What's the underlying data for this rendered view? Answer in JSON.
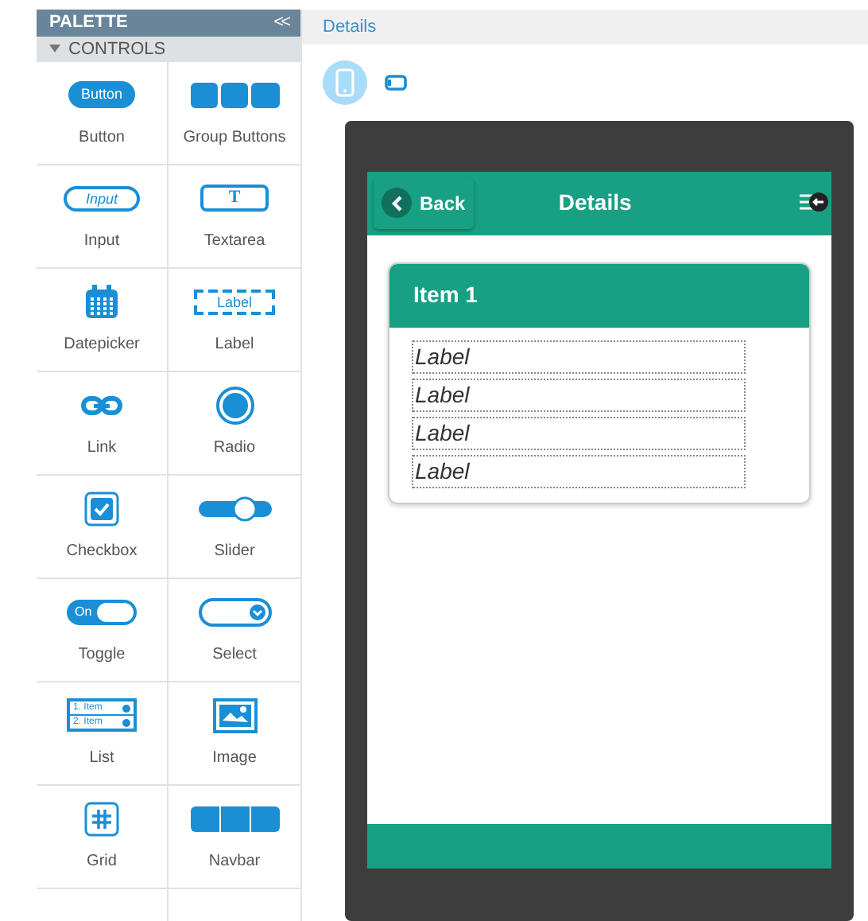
{
  "palette": {
    "title": "PALETTE",
    "collapse": "<<",
    "section": {
      "title": "CONTROLS",
      "expanded": true
    },
    "items": [
      {
        "kind": "button",
        "label": "Button",
        "icon_text": [
          "Button"
        ]
      },
      {
        "kind": "group",
        "label": "Group Buttons"
      },
      {
        "kind": "input",
        "label": "Input",
        "icon_text": [
          "Input"
        ]
      },
      {
        "kind": "textarea",
        "label": "Textarea",
        "icon_text": [
          "T"
        ]
      },
      {
        "kind": "datepicker",
        "label": "Datepicker"
      },
      {
        "kind": "label",
        "label": "Label",
        "icon_text": [
          "Label"
        ]
      },
      {
        "kind": "link",
        "label": "Link"
      },
      {
        "kind": "radio",
        "label": "Radio"
      },
      {
        "kind": "checkbox",
        "label": "Checkbox"
      },
      {
        "kind": "slider",
        "label": "Slider"
      },
      {
        "kind": "toggle",
        "label": "Toggle",
        "icon_text": [
          "On"
        ]
      },
      {
        "kind": "select",
        "label": "Select"
      },
      {
        "kind": "list",
        "label": "List",
        "icon_text": [
          "1. Item",
          "2. Item"
        ]
      },
      {
        "kind": "image",
        "label": "Image"
      },
      {
        "kind": "grid",
        "label": "Grid"
      },
      {
        "kind": "navbar",
        "label": "Navbar"
      }
    ]
  },
  "breadcrumb": "Details",
  "devices": [
    {
      "kind": "phone",
      "selected": true
    },
    {
      "kind": "tablet",
      "selected": false
    }
  ],
  "phone": {
    "header": {
      "back": "Back",
      "title": "Details"
    },
    "card": {
      "title": "Item 1",
      "labels": [
        "Label",
        "Label",
        "Label",
        "Label"
      ]
    }
  }
}
